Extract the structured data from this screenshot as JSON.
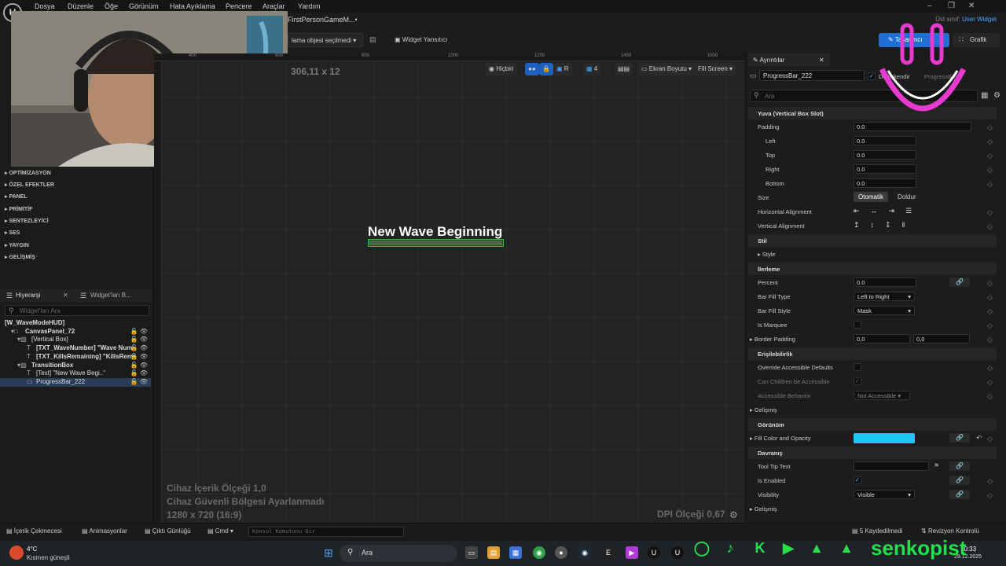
{
  "menubar": {
    "items": [
      "Dosya",
      "Düzenle",
      "Öğe",
      "Görünüm",
      "Hata Ayıklama",
      "Pencere",
      "Araçlar",
      "Yardım"
    ]
  },
  "toolbar": {
    "tab_title": "FirstPersonGameM...•",
    "parent_class_label": "Üst sınıf:",
    "parent_class_value": "User Widget",
    "selection_dropdown": "lama objesi seçilmedi",
    "widget_reflector": "Widget Yansıtıcı",
    "designer_label": "Tasarımcı",
    "graph_label": "Grafik"
  },
  "canvas": {
    "ruler_ticks": [
      "400",
      "600",
      "800",
      "1000",
      "1200",
      "1400",
      "1600"
    ],
    "size_readout": "306,11 x 12",
    "toolbar": {
      "none_label": "Hiçbiri",
      "r_label": "R",
      "grid_value": "4",
      "screen_size_label": "Ekran Boyutu",
      "fill_screen_label": "Fill Screen"
    },
    "wave_text": "New Wave Beginning",
    "info_lines": [
      "Cihaz İçerik Ölçeği 1,0",
      "Cihaz Güvenli Bölgesi Ayarlanmadı",
      "1280 x 720 (16:9)"
    ],
    "dpi_label": "DPI Ölçeği 0,67"
  },
  "palette": {
    "categories": [
      "OPTİMİZASYON",
      "ÖZEL EFEKTLER",
      "PANEL",
      "PRİMİTİF",
      "SENTEZLEYİCİ",
      "SES",
      "YAYGIN",
      "GELİŞMİŞ"
    ]
  },
  "hierarchy": {
    "tab_label": "Hiyerarşi",
    "tab2_label": "Widget'ları B...",
    "search_placeholder": "Widget'ları Ara",
    "rows": [
      {
        "label": "[W_WaveModeHUD]",
        "indent": 0,
        "bold": true
      },
      {
        "label": "CanvasPanel_72",
        "indent": 1,
        "bold": true
      },
      {
        "label": "[Vertical Box]",
        "indent": 2,
        "bold": false
      },
      {
        "label": "[TXT_WaveNumber] \"Wave Num",
        "indent": 3,
        "bold": true
      },
      {
        "label": "[TXT_KillsRemaining] \"KillsRema",
        "indent": 3,
        "bold": true
      },
      {
        "label": "TransitionBox",
        "indent": 2,
        "bold": true
      },
      {
        "label": "[Text] \"New Wave Begi..\"",
        "indent": 3,
        "bold": false
      },
      {
        "label": "ProgressBar_222",
        "indent": 3,
        "bold": false
      }
    ]
  },
  "details": {
    "tab_label": "Ayrıntılar",
    "name_value": "ProgressBar_222",
    "is_variable_label": "Değişkendir",
    "class_label": "ProgressBar",
    "search_placeholder": "Ara",
    "sections": {
      "slot": "Yuva (Vertical Box Slot)",
      "style": "Stil",
      "progress": "İlerleme",
      "accessibility": "Erişilebilirlik",
      "appearance": "Görünüm",
      "behavior": "Davranış"
    },
    "padding": {
      "label": "Padding",
      "value": "0.0",
      "left": "0.0",
      "top": "0.0",
      "right": "0.0",
      "bottom": "0.0",
      "left_label": "Left",
      "top_label": "Top",
      "right_label": "Right",
      "bottom_label": "Bottom"
    },
    "size": {
      "label": "Size",
      "auto": "Otomatik",
      "fill": "Doldur"
    },
    "h_align_label": "Horizontal Alignment",
    "v_align_label": "Vertical Alignment",
    "style_label": "Style",
    "percent": {
      "label": "Percent",
      "value": "0.0"
    },
    "bar_fill_type": {
      "label": "Bar Fill Type",
      "value": "Left to Right"
    },
    "bar_fill_style": {
      "label": "Bar Fill Style",
      "value": "Mask"
    },
    "is_marquee_label": "Is Marquee",
    "border_padding": {
      "label": "Border Padding",
      "x": "0,0",
      "y": "0,0"
    },
    "override_accessible_label": "Override Accessible Defaults",
    "can_children_label": "Can Children be Accessible",
    "accessible_behavior": {
      "label": "Accessible Behavior",
      "value": "Not Accessible"
    },
    "advanced_label": "Gelişmiş",
    "fill_color": {
      "label": "Fill Color and Opacity",
      "color": "#1ec8f5"
    },
    "tooltip_label": "Tool Tip Text",
    "is_enabled_label": "Is Enabled",
    "visibility": {
      "label": "Visibility",
      "value": "Visible"
    },
    "advanced2_label": "Gelişmiş"
  },
  "bottombar": {
    "content_drawer": "İçerik Çekmecesi",
    "animations": "Animasyonlar",
    "output_log": "Çıktı Günlüğü",
    "cmd": "Cmd",
    "console_placeholder": "Konsol Komutunu Gir",
    "saved": "5 Kaydedilmedi",
    "revision": "Revizyon Kontrolü"
  },
  "taskbar": {
    "weather_temp": "4°C",
    "weather_desc": "Kısmen güneşli",
    "search_label": "Ara",
    "time": "10:33",
    "date": "29.12.2025"
  },
  "overlay": {
    "channel_name": "senkopist",
    "accent_color": "#25e04a"
  }
}
